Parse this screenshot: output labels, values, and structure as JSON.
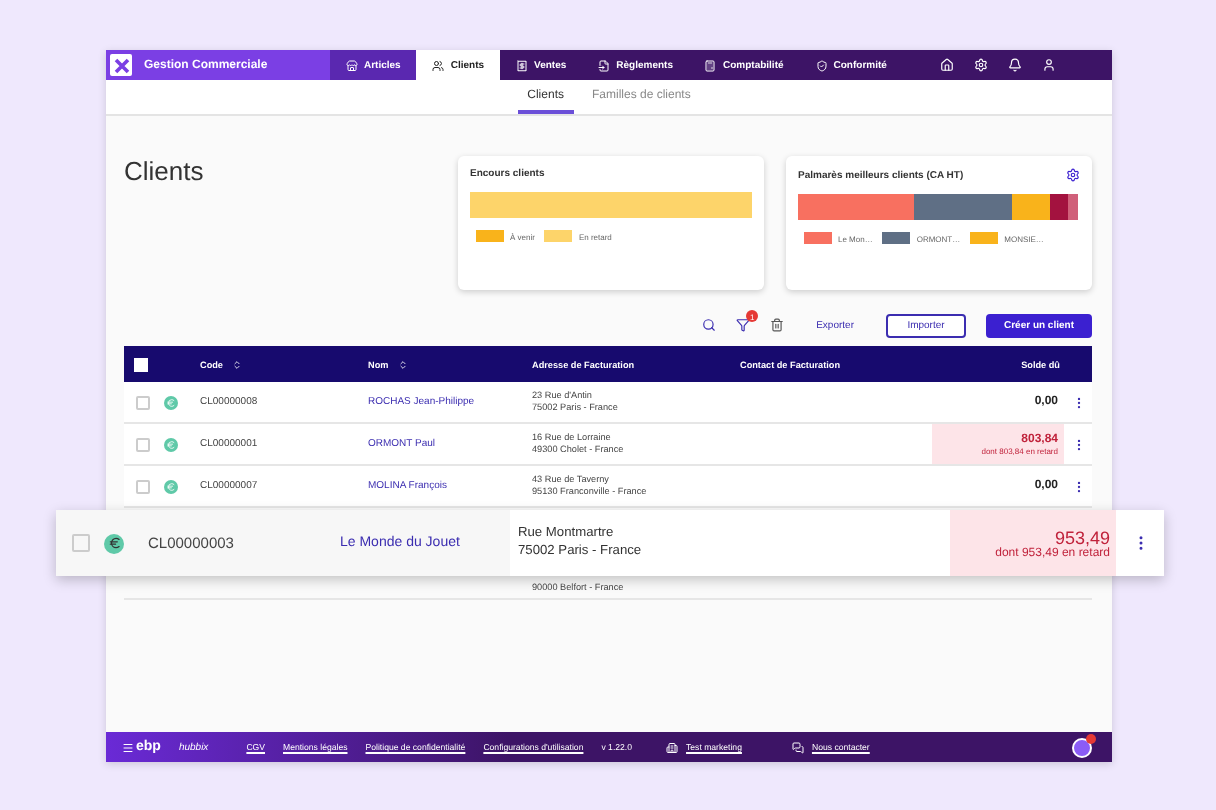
{
  "app": {
    "title": "Gestion Commerciale"
  },
  "nav": [
    {
      "label": "Articles",
      "selected": false
    },
    {
      "label": "Clients",
      "selected": true
    },
    {
      "label": "Ventes",
      "selected": false
    },
    {
      "label": "Règlements",
      "selected": false
    },
    {
      "label": "Comptabilité",
      "selected": false
    },
    {
      "label": "Conformité",
      "selected": false
    }
  ],
  "subtabs": [
    {
      "label": "Clients",
      "selected": true
    },
    {
      "label": "Familles de clients",
      "selected": false
    }
  ],
  "page_title": "Clients",
  "cards": [
    {
      "title": "Encours clients",
      "legend": [
        {
          "label": "À venir",
          "color": "#f9b31b"
        },
        {
          "label": "En retard",
          "color": "#fdd46a"
        }
      ]
    },
    {
      "title": "Palmarès meilleurs clients (CA HT)",
      "legend": [
        {
          "label": "Le Mon…",
          "color": "#f87060"
        },
        {
          "label": "ORMONT…",
          "color": "#5f6f85"
        },
        {
          "label": "MONSIE…",
          "color": "#f9b31b"
        }
      ]
    }
  ],
  "toolbar": {
    "filter_count": "1",
    "export": "Exporter",
    "import": "Importer",
    "create": "Créer un client"
  },
  "table": {
    "select_all_checked": false,
    "columns": [
      {
        "label": "Code",
        "sortable": true
      },
      {
        "label": "Nom",
        "sortable": true
      },
      {
        "label": "Adresse de Facturation",
        "sortable": false
      },
      {
        "label": "Contact de Facturation",
        "sortable": false
      },
      {
        "label": "Solde dû",
        "sortable": false
      }
    ],
    "rows": [
      {
        "code": "CL00000008",
        "name": "ROCHAS Jean-Philippe",
        "address": [
          "23 Rue d'Antin",
          "75002 Paris - France"
        ],
        "balance": "0,00",
        "overdue": false,
        "checked": false
      },
      {
        "code": "CL00000001",
        "name": "ORMONT Paul",
        "address": [
          "16 Rue de Lorraine",
          "49300 Cholet - France"
        ],
        "balance": "803,84",
        "overdue": true,
        "overdue_note": "dont 803,84 en retard",
        "checked": false
      },
      {
        "code": "CL00000007",
        "name": "MOLINA François",
        "address": [
          "43 Rue de Taverny",
          "95130 Franconville - France"
        ],
        "balance": "0,00",
        "overdue": false,
        "checked": false
      },
      {
        "address": [
          "90000 Belfort - France"
        ]
      }
    ]
  },
  "highlighted_row": {
    "code": "CL00000003",
    "name": "Le Monde du Jouet",
    "address": [
      "Rue Montmartre",
      "75002 Paris - France"
    ],
    "balance": "953,49",
    "overdue": true,
    "overdue_note": "dont 953,49 en retard",
    "checked": false
  },
  "footer": {
    "brand": "ebp",
    "product": "hubbix",
    "links": [
      "CGV",
      "Mentions légales",
      "Politique de confidentialité",
      "Configurations d'utilisation"
    ],
    "version": "v 1.22.0",
    "marketing": "Test marketing",
    "contact": "Nous contacter"
  }
}
